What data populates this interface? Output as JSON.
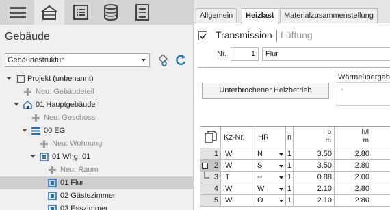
{
  "left_panel": {
    "title": "Gebäude",
    "structure_select": "Gebäudestruktur",
    "toolbar": [
      "menu-icon",
      "building-icon",
      "list-icon",
      "database-icon",
      "form-icon"
    ],
    "tree": [
      {
        "label": "Projekt (unbenannt)",
        "kind": "project"
      },
      {
        "label": "Neu: Gebäudeteil",
        "kind": "add"
      },
      {
        "label": "01 Hauptgebäude",
        "kind": "building"
      },
      {
        "label": "Neu: Geschoss",
        "kind": "add"
      },
      {
        "label": "00 EG",
        "kind": "floor"
      },
      {
        "label": "Neu: Wohnung",
        "kind": "add"
      },
      {
        "label": "01 Whg. 01",
        "kind": "apartment"
      },
      {
        "label": "Neu: Raum",
        "kind": "add"
      },
      {
        "label": "01 Flur",
        "kind": "room"
      },
      {
        "label": "02 Gästezimmer",
        "kind": "room"
      },
      {
        "label": "03 Esszimmer",
        "kind": "room"
      }
    ]
  },
  "right_panel": {
    "tabs": [
      "Allgemein",
      "Heizlast",
      "Materialzusammenstellung"
    ],
    "active_tab": "Heizlast",
    "transmission_label": "Transmission",
    "lueftung_label": "Lüftung",
    "nr_label": "Nr.",
    "nr_value": "1",
    "room_name": "Flur",
    "interrupt_button": "Unterbrochener Heizbetrieb",
    "waermeuebergabe_label": "Wärmeübergabe",
    "waermeuebergabe_value": "-",
    "table": {
      "headers": {
        "kz": "Kz-Nr.",
        "hr": "HR",
        "n": "n",
        "b_top": "b",
        "b_unit": "m",
        "hl_top": "h/l",
        "hl_unit": "m"
      },
      "rows": [
        {
          "no": "1",
          "kz": "IW",
          "hr": "N",
          "n": "1",
          "b": "3.50",
          "hl": "2.80"
        },
        {
          "no": "2",
          "kz": "IW",
          "hr": "S",
          "n": "1",
          "b": "3.50",
          "hl": "2.80"
        },
        {
          "no": "3",
          "kz": "IT",
          "hr": "--",
          "n": "1",
          "b": "0.88",
          "hl": "2.00"
        },
        {
          "no": "4",
          "kz": "IW",
          "hr": "W",
          "n": "1",
          "b": "2.10",
          "hl": "2.80"
        },
        {
          "no": "5",
          "kz": "IW",
          "hr": "O",
          "n": "1",
          "b": "2.10",
          "hl": "2.80"
        }
      ]
    }
  },
  "colors": {
    "accent_blue": "#1e73be",
    "toolbar_bg": "#d4d4d4",
    "add_icon_gray": "#9a9a9a",
    "selected_row": "#cfcfcf"
  }
}
